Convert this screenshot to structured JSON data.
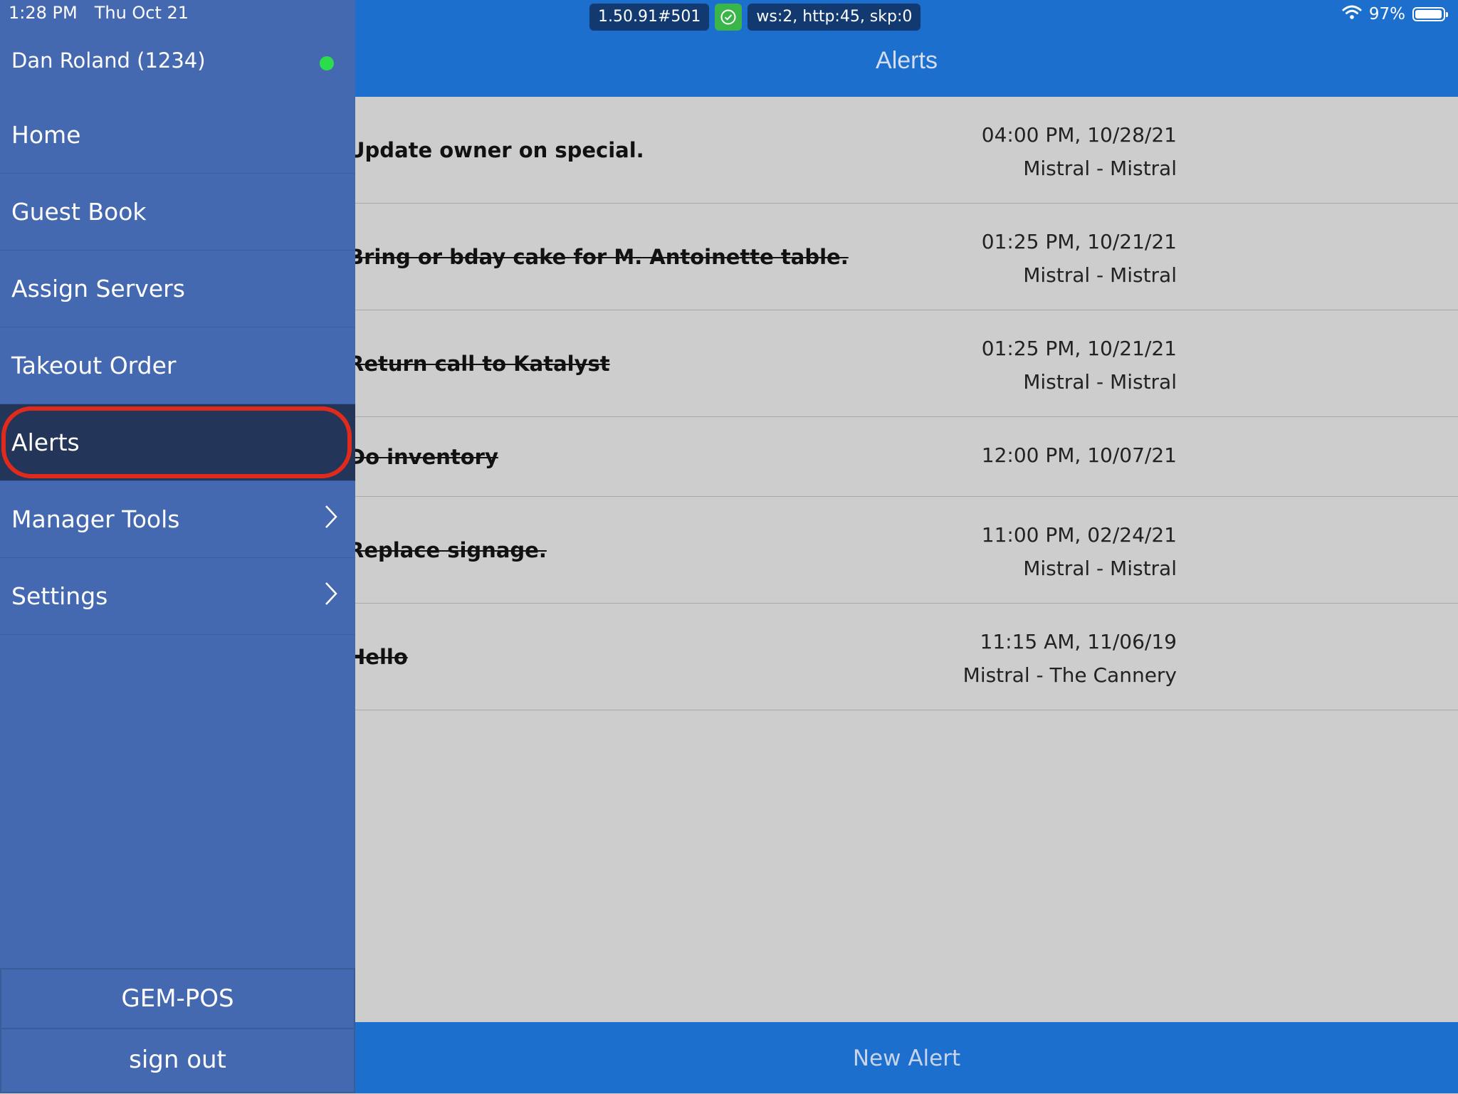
{
  "status_bar": {
    "time": "1:28 PM",
    "date": "Thu Oct 21",
    "battery": "97%",
    "battery_level": 0.97,
    "wifi_icon": "wifi-icon"
  },
  "debug": {
    "version": "1.50.91#501",
    "stats": "ws:2, http:45, skp:0",
    "status_icon": "check-circle-icon"
  },
  "header": {
    "title": "Alerts"
  },
  "sidebar": {
    "user": "Dan Roland (1234)",
    "items": [
      {
        "label": "Home"
      },
      {
        "label": "Guest Book"
      },
      {
        "label": "Assign Servers"
      },
      {
        "label": "Takeout Order"
      },
      {
        "label": "Alerts"
      },
      {
        "label": "Manager Tools"
      },
      {
        "label": "Settings"
      }
    ],
    "app_name": "GEM-POS",
    "sign_out": "sign out"
  },
  "alerts": [
    {
      "title": "Update owner on special.",
      "time": "04:00 PM, 10/28/21",
      "location": "Mistral - Mistral",
      "done": false
    },
    {
      "title": "Bring or bday cake for M. Antoinette table.",
      "time": "01:25 PM, 10/21/21",
      "location": "Mistral - Mistral",
      "done": true
    },
    {
      "title": "Return call to Katalyst",
      "time": "01:25 PM, 10/21/21",
      "location": "Mistral - Mistral",
      "done": true
    },
    {
      "title": "Do inventory",
      "time": "12:00 PM, 10/07/21",
      "location": "",
      "done": true
    },
    {
      "title": "Replace signage.",
      "time": "11:00 PM, 02/24/21",
      "location": "Mistral - Mistral",
      "done": true
    },
    {
      "title": "Hello",
      "time": "11:15 AM, 11/06/19",
      "location": "Mistral - The Cannery",
      "done": true
    }
  ],
  "footer": {
    "new_alert": "New Alert"
  },
  "colors": {
    "header_blue": "#1d6fcd",
    "sidebar_blue": "#4569b1",
    "active_item": "#233559",
    "highlight_ring": "#e02b1c",
    "online_dot": "#2bdc4c"
  }
}
